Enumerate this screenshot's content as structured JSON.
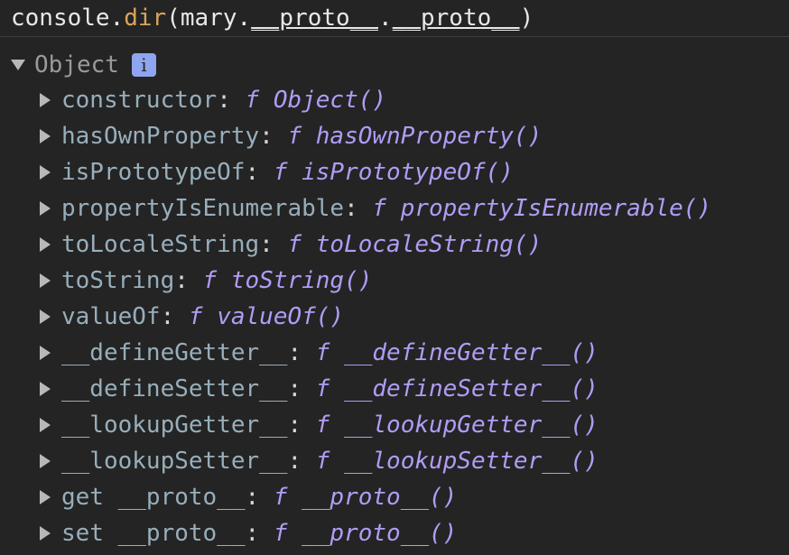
{
  "command": {
    "prefix": "console.",
    "fn": "dir",
    "open": "(mary.",
    "p1": "__proto__",
    "dot": ".",
    "p2": "__proto__",
    "close": ")"
  },
  "object": {
    "label": "Object",
    "info_icon": "info-icon",
    "info_glyph": "i"
  },
  "properties": [
    {
      "key": "constructor",
      "f": "f",
      "value": "Object()"
    },
    {
      "key": "hasOwnProperty",
      "f": "f",
      "value": "hasOwnProperty()"
    },
    {
      "key": "isPrototypeOf",
      "f": "f",
      "value": "isPrototypeOf()"
    },
    {
      "key": "propertyIsEnumerable",
      "f": "f",
      "value": "propertyIsEnumerable()"
    },
    {
      "key": "toLocaleString",
      "f": "f",
      "value": "toLocaleString()"
    },
    {
      "key": "toString",
      "f": "f",
      "value": "toString()"
    },
    {
      "key": "valueOf",
      "f": "f",
      "value": "valueOf()"
    },
    {
      "key": "__defineGetter__",
      "f": "f",
      "value": "__defineGetter__()"
    },
    {
      "key": "__defineSetter__",
      "f": "f",
      "value": "__defineSetter__()"
    },
    {
      "key": "__lookupGetter__",
      "f": "f",
      "value": "__lookupGetter__()"
    },
    {
      "key": "__lookupSetter__",
      "f": "f",
      "value": "__lookupSetter__()"
    },
    {
      "key": "get __proto__",
      "f": "f",
      "value": "__proto__()"
    },
    {
      "key": "set __proto__",
      "f": "f",
      "value": "__proto__()"
    }
  ],
  "colon": ": "
}
